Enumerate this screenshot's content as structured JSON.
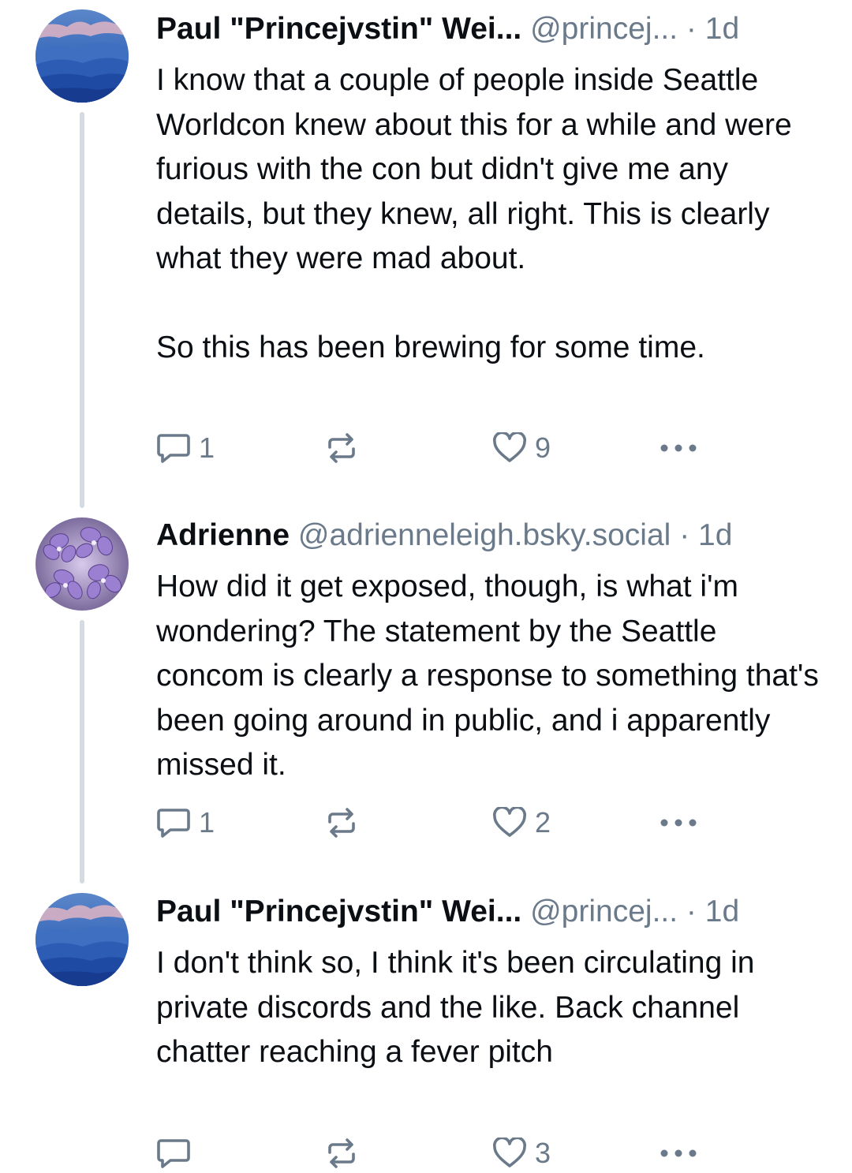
{
  "posts": [
    {
      "author_name": "Paul \"Princejvstin\" Wei...",
      "handle": "@princej...",
      "separator": "·",
      "time": "1d",
      "text": "I know that a couple of people inside Seattle Worldcon knew about this for a while and were furious with the con but didn't give me any details, but they knew, all right. This is clearly what they were mad about.\n\nSo this has been brewing for some time.",
      "reply_count": "1",
      "repost_count": "",
      "like_count": "9",
      "avatar_icon": "mountain-landscape-avatar"
    },
    {
      "author_name": "Adrienne",
      "handle": "@adrienneleigh.bsky.social",
      "separator": "·",
      "time": "1d",
      "text": "How did it get exposed, though, is what i'm wondering? The statement by the Seattle concom is clearly a response to something that's been going around in public, and i apparently missed it.",
      "reply_count": "1",
      "repost_count": "",
      "like_count": "2",
      "avatar_icon": "violet-flowers-avatar"
    },
    {
      "author_name": "Paul \"Princejvstin\" Wei...",
      "handle": "@princej...",
      "separator": "·",
      "time": "1d",
      "text": "I don't think so, I think it's been circulating in private discords and the like. Back channel chatter reaching a fever pitch",
      "reply_count": "",
      "repost_count": "",
      "like_count": "3",
      "avatar_icon": "mountain-landscape-avatar"
    }
  ],
  "colors": {
    "text": "#0b0f14",
    "muted": "#6b7a8a",
    "thread_line": "#d4dbe2"
  }
}
